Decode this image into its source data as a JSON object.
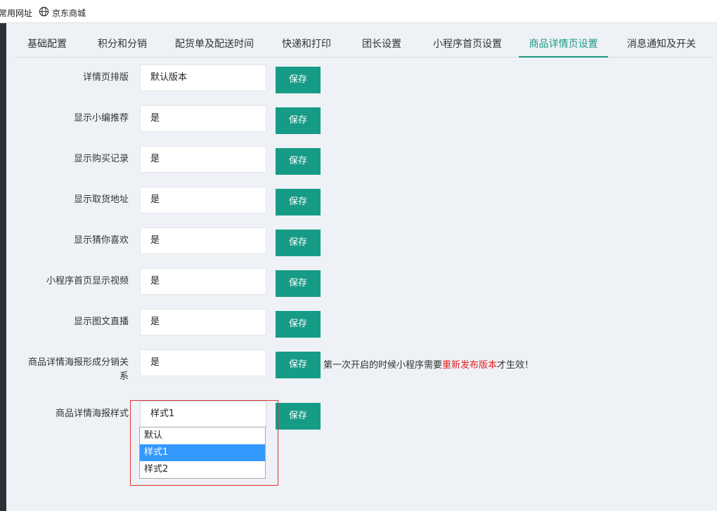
{
  "bookmarks": [
    {
      "label": "常用网址",
      "icon": null
    },
    {
      "label": "京东商城",
      "icon": "globe-icon"
    }
  ],
  "tabs": [
    {
      "label": "基础配置",
      "active": false
    },
    {
      "label": "积分和分销",
      "active": false
    },
    {
      "label": "配货单及配送时间",
      "active": false
    },
    {
      "label": "快递和打印",
      "active": false
    },
    {
      "label": "团长设置",
      "active": false
    },
    {
      "label": "小程序首页设置",
      "active": false
    },
    {
      "label": "商品详情页设置",
      "active": true
    },
    {
      "label": "消息通知及开关",
      "active": false
    }
  ],
  "colors": {
    "accent": "#169b86",
    "active_tab": "#1e9a85",
    "warning": "#e02020",
    "selection": "#3399ff"
  },
  "settings": [
    {
      "label": "详情页排版",
      "value": "默认版本",
      "button": "保存"
    },
    {
      "label": "显示小编推荐",
      "value": "是",
      "button": "保存"
    },
    {
      "label": "显示购买记录",
      "value": "是",
      "button": "保存"
    },
    {
      "label": "显示取货地址",
      "value": "是",
      "button": "保存"
    },
    {
      "label": "显示猜你喜欢",
      "value": "是",
      "button": "保存"
    },
    {
      "label": "小程序首页显示视频",
      "value": "是",
      "button": "保存"
    },
    {
      "label": "显示图文直播",
      "value": "是",
      "button": "保存"
    },
    {
      "label_line1": "商品详情海报形成分销关",
      "label_line2": "系",
      "value": "是",
      "button": "保存"
    },
    {
      "label": "商品详情海报样式",
      "value": "样式1",
      "button": "保存"
    }
  ],
  "note": {
    "before": "第一次开启的时候小程序需要",
    "highlight": "重新发布版本",
    "after": "才生效！"
  },
  "dropdown_options": [
    {
      "label": "默认",
      "selected": false
    },
    {
      "label": "样式1",
      "selected": true
    },
    {
      "label": "样式2",
      "selected": false
    }
  ]
}
